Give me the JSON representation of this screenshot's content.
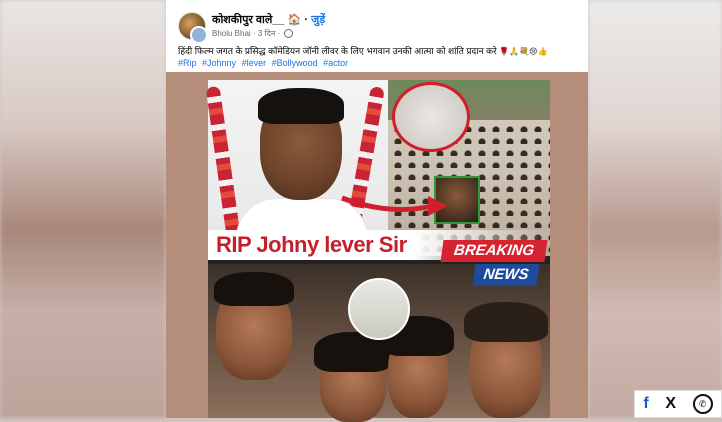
{
  "post": {
    "group_name": "कोशकीपुर वाले__",
    "join_label": "जुड़ें",
    "separator": "·",
    "author": "Bholu Bhai",
    "time": "3 दिन",
    "caption": "हिंदी फिल्म जगत के प्रसिद्ध कॉमेडियन जॉनी लीवर के लिए भगवान उनकी आत्मा को शांति प्रदान करे",
    "caption_emojis": [
      "🌹",
      "🙏",
      "💐",
      "😢",
      "👍"
    ],
    "hashtags": [
      "#Rip",
      "#Johnny",
      "#lever",
      "#Bollywood",
      "#actor"
    ]
  },
  "image_text": {
    "rip": "RIP Johny lever Sir",
    "breaking": "BREAKING",
    "news": "NEWS"
  },
  "share": {
    "facebook": "f",
    "x": "X",
    "whatsapp": "✆"
  },
  "colors": {
    "link_blue": "#1b74e4",
    "rip_red": "#c41f2b",
    "breaking_red": "#d6232f",
    "news_blue": "#1d4a9a"
  }
}
